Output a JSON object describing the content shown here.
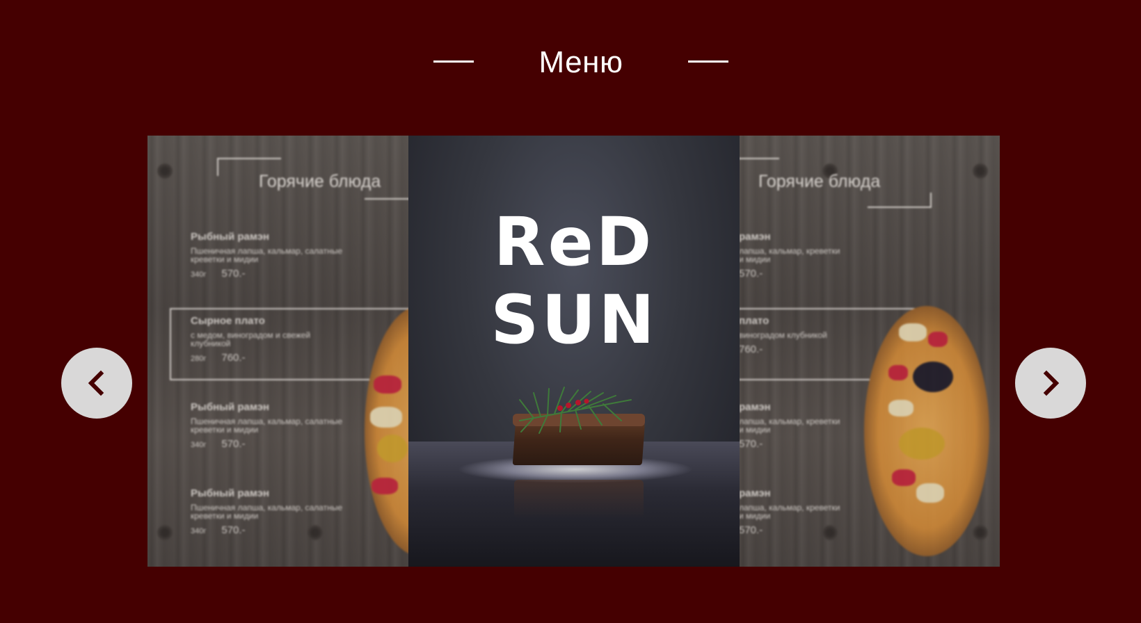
{
  "heading": {
    "title": "Меню"
  },
  "carousel": {
    "prev_icon": "chevron-left-icon",
    "next_icon": "chevron-right-icon",
    "cover": {
      "logo_line1": "ReD",
      "logo_line2": "SUN"
    },
    "left_page": {
      "section_title": "Горячие блюда",
      "items": [
        {
          "name": "Рыбный рамэн",
          "desc": "Пшеничная лапша, кальмар, салатные креветки и мидии",
          "weight": "340г",
          "price": "570.-"
        },
        {
          "name": "Сырное плато",
          "desc": "с медом, виноградом и свежей клубникой",
          "weight": "280г",
          "price": "760.-"
        },
        {
          "name": "Рыбный рамэн",
          "desc": "Пшеничная лапша, кальмар, салатные креветки и мидии",
          "weight": "340г",
          "price": "570.-"
        },
        {
          "name": "Рыбный рамэн",
          "desc": "Пшеничная лапша, кальмар, салатные креветки и мидии",
          "weight": "340г",
          "price": "570.-"
        }
      ]
    },
    "right_page": {
      "section_title": "Горячие блюда",
      "items": [
        {
          "name": "рамэн",
          "desc": "лапша, кальмар, креветки и мидии",
          "price": "570.-"
        },
        {
          "name": "плато",
          "desc": "виноградом клубникой",
          "price": "760.-"
        },
        {
          "name": "рамэн",
          "desc": "лапша, кальмар, креветки и мидии",
          "price": "570.-"
        },
        {
          "name": "рамэн",
          "desc": "лапша, кальмар, креветки и мидии",
          "price": "570.-"
        }
      ]
    }
  },
  "colors": {
    "background": "#450001",
    "button": "#d9d8d8",
    "chevron": "#450001"
  }
}
